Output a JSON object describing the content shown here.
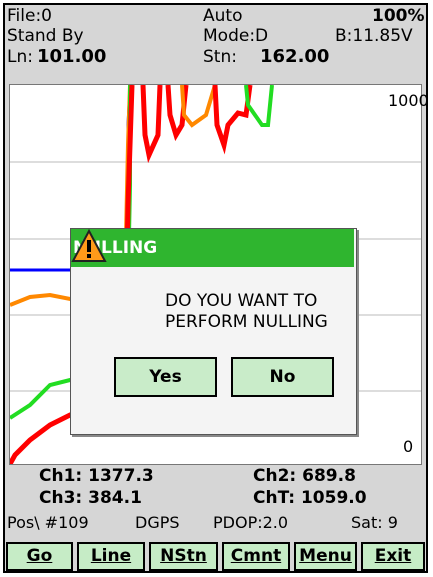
{
  "status": {
    "file": "File:0",
    "mode_auto": "Auto",
    "percent": "100%",
    "state": "Stand By",
    "mode": "Mode:D",
    "battery": "B:11.85V",
    "line_label": "Ln:",
    "line_value": "101.00",
    "station_label": "Stn:",
    "station_value": "162.00"
  },
  "chart": {
    "y_max_label": "1000",
    "y_min_label": "0",
    "colors": {
      "red": "#ff0000",
      "green": "#22dd22",
      "orange": "#ff8800",
      "blue": "#0000ff",
      "grid": "#bbbbbb"
    }
  },
  "dialog": {
    "title": "NULLING",
    "message_line1": "DO YOU WANT TO",
    "message_line2": "PERFORM NULLING",
    "yes_label": "Yes",
    "no_label": "No",
    "icon": "warning-icon"
  },
  "readouts": {
    "ch1": "Ch1:  1377.3",
    "ch2": "Ch2:   689.8",
    "ch3": "Ch3:   384.1",
    "cht": "ChT:  1059.0"
  },
  "gps": {
    "pos": "Pos\\ #109",
    "fix": "DGPS",
    "pdop": "PDOP:2.0",
    "sat": "Sat: 9"
  },
  "toolbar": {
    "go": "Go",
    "line": "Line",
    "nstn": "NStn",
    "cmnt": "Cmnt",
    "menu": "Menu",
    "exit": "Exit"
  }
}
